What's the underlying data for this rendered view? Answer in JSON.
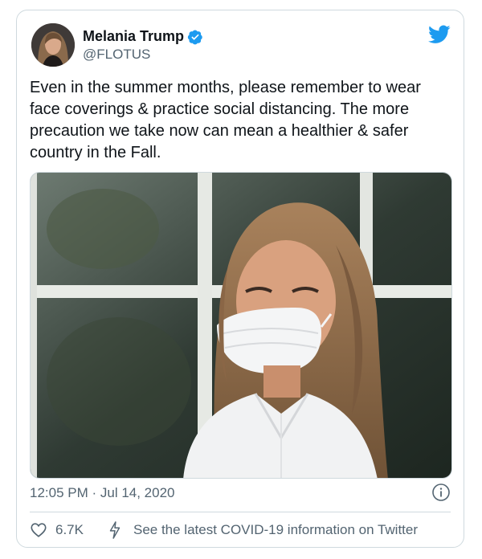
{
  "tweet": {
    "author_name": "Melania Trump",
    "handle": "@FLOTUS",
    "text": "Even in the summer months, please remember to wear face coverings & practice social distancing. The more precaution we take now can mean a healthier & safer country in the Fall.",
    "timestamp": "12:05 PM · Jul 14, 2020",
    "like_count": "6.7K",
    "covid_link": "See the latest COVID-19 information on Twitter"
  },
  "icons": {
    "verified": "verified-badge-icon",
    "logo": "twitter-bird-icon",
    "info": "info-icon",
    "like": "heart-icon",
    "covid": "lightning-bolt-icon"
  },
  "colors": {
    "brand_blue": "#1d9bf0",
    "text_primary": "#0f1419",
    "text_secondary": "#536471",
    "border": "#cfd9de"
  }
}
